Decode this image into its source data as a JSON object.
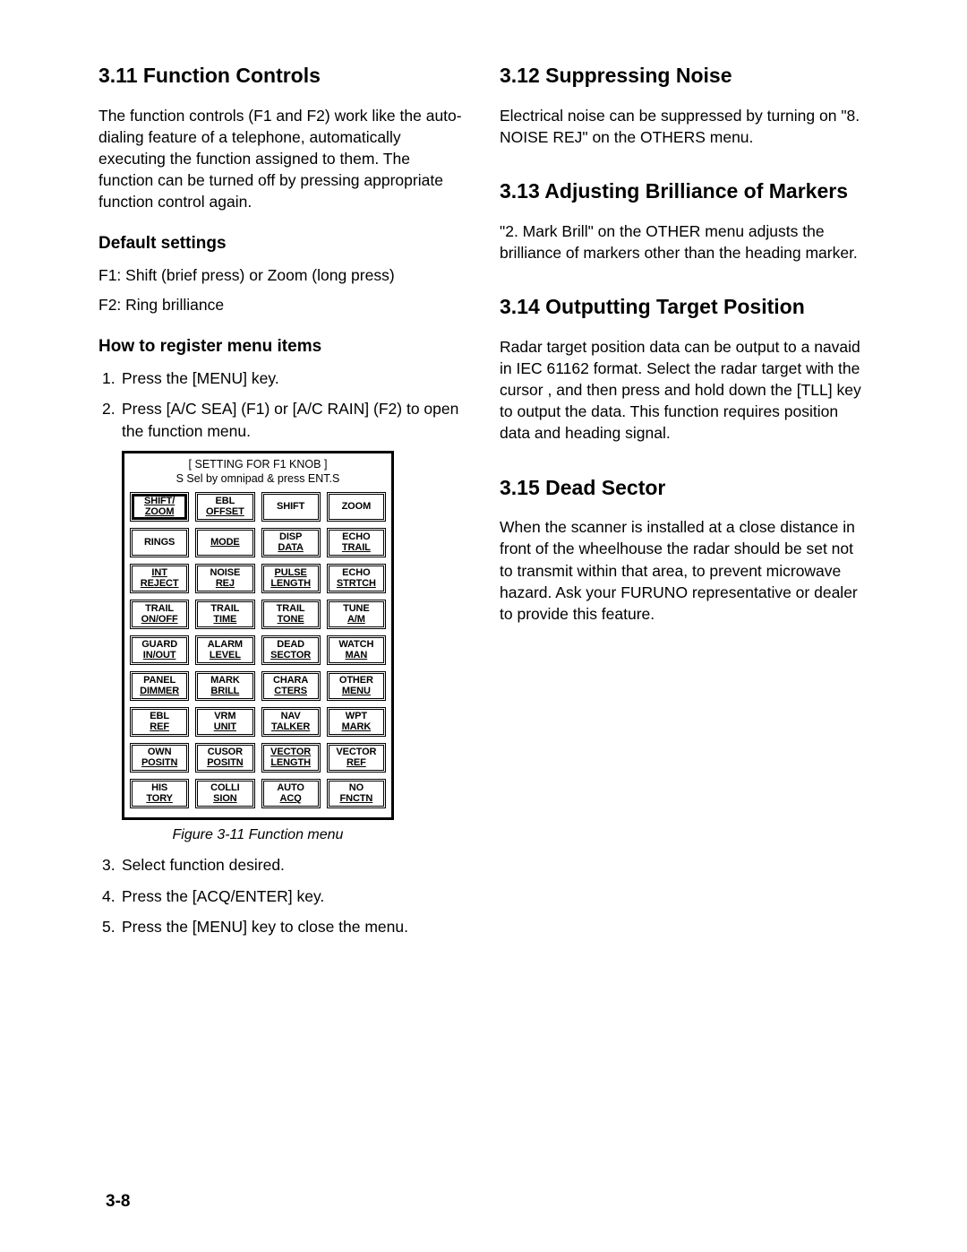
{
  "left": {
    "h_311": "3.11 Function Controls",
    "p_311": "The function controls (F1 and F2) work like the auto-dialing feature of a telephone, automatically executing the function assigned to them. The function can be turned off by pressing appropriate function control again.",
    "h_defaults": "Default settings",
    "p_f1": "F1: Shift (brief press) or Zoom (long press)",
    "p_f2": "F2: Ring brilliance",
    "h_register": "How to register menu items",
    "steps_top": [
      {
        "n": "1.",
        "t": "Press the [MENU] key."
      },
      {
        "n": "2.",
        "t": "Press [A/C SEA] (F1) or [A/C RAIN] (F2) to open the function menu."
      }
    ],
    "menu_title_line1": "[ SETTING FOR F1 KNOB ]",
    "menu_title_line2": "S Sel by omnipad & press ENT.S",
    "buttons": [
      {
        "l1": "SHIFT/",
        "l2": "ZOOM",
        "u": "both",
        "sel": true
      },
      {
        "l1": "EBL",
        "l2": "OFFSET",
        "u": "l2"
      },
      {
        "l1": "SHIFT",
        "l2": "",
        "u": "none"
      },
      {
        "l1": "ZOOM",
        "l2": "",
        "u": "none"
      },
      {
        "l1": "RINGS",
        "l2": "",
        "u": "none"
      },
      {
        "l1": "MODE",
        "l2": "",
        "u": "l1"
      },
      {
        "l1": "DISP",
        "l2": "DATA",
        "u": "l2"
      },
      {
        "l1": "ECHO",
        "l2": "TRAIL",
        "u": "l2"
      },
      {
        "l1": "INT",
        "l2": "REJECT",
        "u": "both"
      },
      {
        "l1": "NOISE",
        "l2": "REJ",
        "u": "l2"
      },
      {
        "l1": "PULSE",
        "l2": "LENGTH",
        "u": "both"
      },
      {
        "l1": "ECHO",
        "l2": "STRTCH",
        "u": "l2"
      },
      {
        "l1": "TRAIL",
        "l2": "ON/OFF",
        "u": "l2"
      },
      {
        "l1": "TRAIL",
        "l2": "TIME",
        "u": "l2"
      },
      {
        "l1": "TRAIL",
        "l2": "TONE",
        "u": "l2"
      },
      {
        "l1": "TUNE",
        "l2": "A/M",
        "u": "l2"
      },
      {
        "l1": "GUARD",
        "l2": "IN/OUT",
        "u": "l2"
      },
      {
        "l1": "ALARM",
        "l2": "LEVEL",
        "u": "l2"
      },
      {
        "l1": "DEAD",
        "l2": "SECTOR",
        "u": "l2"
      },
      {
        "l1": "WATCH",
        "l2": "MAN",
        "u": "l2"
      },
      {
        "l1": "PANEL",
        "l2": "DIMMER",
        "u": "l2"
      },
      {
        "l1": "MARK",
        "l2": "BRILL",
        "u": "l2"
      },
      {
        "l1": "CHARA",
        "l2": "CTERS",
        "u": "l2"
      },
      {
        "l1": "OTHER",
        "l2": "MENU",
        "u": "l2"
      },
      {
        "l1": "EBL",
        "l2": "REF",
        "u": "l2"
      },
      {
        "l1": "VRM",
        "l2": "UNIT",
        "u": "l2"
      },
      {
        "l1": "NAV",
        "l2": "TALKER",
        "u": "l2"
      },
      {
        "l1": "WPT",
        "l2": "MARK",
        "u": "l2"
      },
      {
        "l1": "OWN",
        "l2": "POSITN",
        "u": "l2"
      },
      {
        "l1": "CUSOR",
        "l2": "POSITN",
        "u": "l2"
      },
      {
        "l1": "VECTOR",
        "l2": "LENGTH",
        "u": "both"
      },
      {
        "l1": "VECTOR",
        "l2": "REF",
        "u": "l2"
      },
      {
        "l1": "HIS",
        "l2": "TORY",
        "u": "l2"
      },
      {
        "l1": "COLLI",
        "l2": "SION",
        "u": "l2"
      },
      {
        "l1": "AUTO",
        "l2": "ACQ",
        "u": "l2"
      },
      {
        "l1": "NO",
        "l2": "FNCTN",
        "u": "l2"
      }
    ],
    "fig_caption": "Figure 3-11 Function menu",
    "steps_bottom": [
      {
        "n": "3.",
        "t": "Select function desired."
      },
      {
        "n": "4.",
        "t": "Press the [ACQ/ENTER] key."
      },
      {
        "n": "5.",
        "t": "Press the [MENU] key to close the menu."
      }
    ]
  },
  "right": {
    "h_312": "3.12 Suppressing Noise",
    "p_312": "Electrical noise can be suppressed by turning on \"8. NOISE REJ\" on the OTHERS menu.",
    "h_313": "3.13 Adjusting Brilliance of Markers",
    "p_313": "\"2. Mark Brill\" on the OTHER menu adjusts the brilliance of markers other than the heading marker.",
    "h_314": "3.14 Outputting Target Position",
    "p_314": "Radar target position data can be output to a navaid in IEC 61162 format. Select the radar target with the cursor , and then press and hold down the [TLL] key to output the data. This function requires position data and heading signal.",
    "h_315": "3.15 Dead Sector",
    "p_315": "When the scanner is installed at a close distance in front of the wheelhouse the radar should be set not to transmit within that area, to prevent microwave hazard.  Ask your FURUNO representative or dealer to provide this feature."
  },
  "page_num": "3-8"
}
